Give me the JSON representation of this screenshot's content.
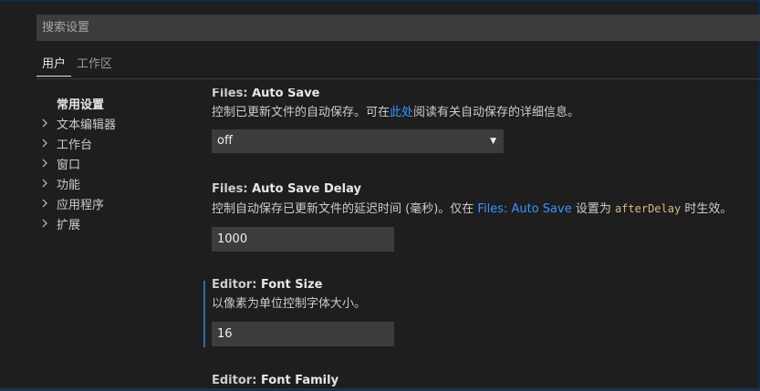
{
  "search": {
    "placeholder": "搜索设置"
  },
  "tabs": [
    {
      "label": "用户",
      "active": true
    },
    {
      "label": "工作区",
      "active": false
    }
  ],
  "toc": [
    {
      "label": "常用设置",
      "expandable": false,
      "active": true
    },
    {
      "label": "文本编辑器",
      "expandable": true,
      "active": false
    },
    {
      "label": "工作台",
      "expandable": true,
      "active": false
    },
    {
      "label": "窗口",
      "expandable": true,
      "active": false
    },
    {
      "label": "功能",
      "expandable": true,
      "active": false
    },
    {
      "label": "应用程序",
      "expandable": true,
      "active": false
    },
    {
      "label": "扩展",
      "expandable": true,
      "active": false
    }
  ],
  "settings": {
    "auto_save": {
      "category": "Files: ",
      "key": "Auto Save",
      "desc_before": "控制已更新文件的自动保存。可在",
      "desc_link": "此处",
      "desc_after": "阅读有关自动保存的详细信息。",
      "value": "off"
    },
    "auto_save_delay": {
      "category": "Files: ",
      "key": "Auto Save Delay",
      "desc_before": "控制自动保存已更新文件的延迟时间 (毫秒)。仅在 ",
      "desc_link": "Files: Auto Save",
      "desc_middle": " 设置为 ",
      "desc_code": "afterDelay",
      "desc_after": " 时生效。",
      "value": "1000"
    },
    "font_size": {
      "category": "Editor: ",
      "key": "Font Size",
      "desc": "以像素为单位控制字体大小。",
      "value": "16"
    },
    "font_family": {
      "category": "Editor: ",
      "key": "Font Family"
    }
  },
  "icons": {
    "chevron": "chevron-right-icon",
    "dropdown": "chevron-down-icon"
  },
  "colors": {
    "link": "#3794ff",
    "code": "#d7ba7d",
    "focus": "#2b6ea8"
  }
}
